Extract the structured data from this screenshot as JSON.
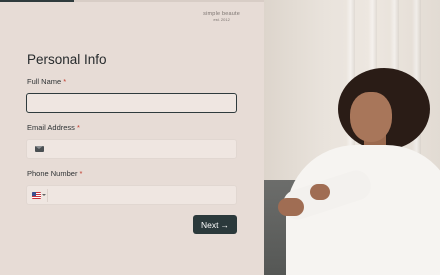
{
  "progress": {
    "fraction": 0.28
  },
  "brand": {
    "name": "simple beaute",
    "established": "est. 2012"
  },
  "form": {
    "title": "Personal Info",
    "required_marker": "*",
    "full_name": {
      "label": "Full Name",
      "value": ""
    },
    "email": {
      "label": "Email Address",
      "value": "",
      "icon": "mail-icon"
    },
    "phone": {
      "label": "Phone Number",
      "value": "",
      "country_flag": "us-flag-icon"
    },
    "next_button": {
      "label": "Next",
      "arrow": "→"
    }
  },
  "colors": {
    "accent": "#2b393b",
    "panel_bg": "#e7dcd6",
    "field_bg": "#efe6e1",
    "required": "#c0392b"
  }
}
